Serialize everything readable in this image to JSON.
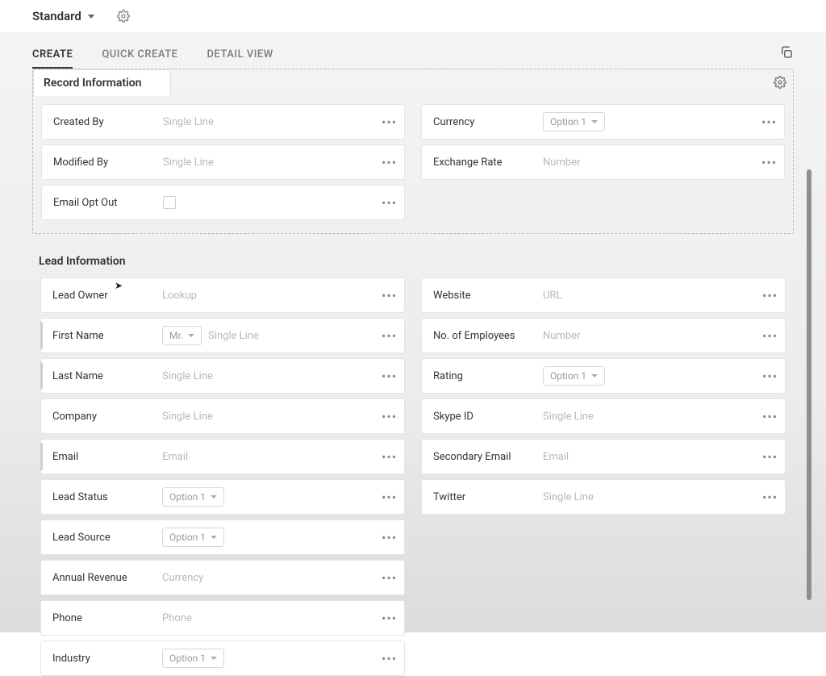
{
  "header": {
    "layout_name": "Standard"
  },
  "tabs": [
    {
      "label": "CREATE",
      "active": true
    },
    {
      "label": "QUICK CREATE",
      "active": false
    },
    {
      "label": "DETAIL VIEW",
      "active": false
    }
  ],
  "record_info_section": {
    "title": "Record Information",
    "left": [
      {
        "name": "created-by",
        "label": "Created By",
        "placeholder": "Single Line",
        "type": "text"
      },
      {
        "name": "modified-by",
        "label": "Modified By",
        "placeholder": "Single Line",
        "type": "text"
      },
      {
        "name": "email-opt-out",
        "label": "Email Opt Out",
        "type": "checkbox"
      }
    ],
    "right": [
      {
        "name": "currency",
        "label": "Currency",
        "placeholder": "Option 1",
        "type": "option"
      },
      {
        "name": "exchange-rate",
        "label": "Exchange Rate",
        "placeholder": "Number",
        "type": "text"
      }
    ]
  },
  "lead_info_section": {
    "title": "Lead Information",
    "left": [
      {
        "name": "lead-owner",
        "label": "Lead Owner",
        "placeholder": "Lookup",
        "type": "text"
      },
      {
        "name": "first-name",
        "label": "First Name",
        "prefix": "Mr.",
        "placeholder": "Single Line",
        "type": "name",
        "required": true
      },
      {
        "name": "last-name",
        "label": "Last Name",
        "placeholder": "Single Line",
        "type": "text",
        "required": true
      },
      {
        "name": "company",
        "label": "Company",
        "placeholder": "Single Line",
        "type": "text"
      },
      {
        "name": "email",
        "label": "Email",
        "placeholder": "Email",
        "type": "text",
        "required": true
      },
      {
        "name": "lead-status",
        "label": "Lead Status",
        "placeholder": "Option 1",
        "type": "option"
      },
      {
        "name": "lead-source",
        "label": "Lead Source",
        "placeholder": "Option 1",
        "type": "option"
      },
      {
        "name": "annual-revenue",
        "label": "Annual Revenue",
        "placeholder": "Currency",
        "type": "text"
      },
      {
        "name": "phone",
        "label": "Phone",
        "placeholder": "Phone",
        "type": "text"
      },
      {
        "name": "industry",
        "label": "Industry",
        "placeholder": "Option 1",
        "type": "option"
      }
    ],
    "right": [
      {
        "name": "website",
        "label": "Website",
        "placeholder": "URL",
        "type": "text"
      },
      {
        "name": "no-of-employees",
        "label": "No. of Employees",
        "placeholder": "Number",
        "type": "text"
      },
      {
        "name": "rating",
        "label": "Rating",
        "placeholder": "Option 1",
        "type": "option"
      },
      {
        "name": "skype-id",
        "label": "Skype ID",
        "placeholder": "Single Line",
        "type": "text"
      },
      {
        "name": "secondary-email",
        "label": "Secondary Email",
        "placeholder": "Email",
        "type": "text"
      },
      {
        "name": "twitter",
        "label": "Twitter",
        "placeholder": "Single Line",
        "type": "text"
      }
    ]
  }
}
